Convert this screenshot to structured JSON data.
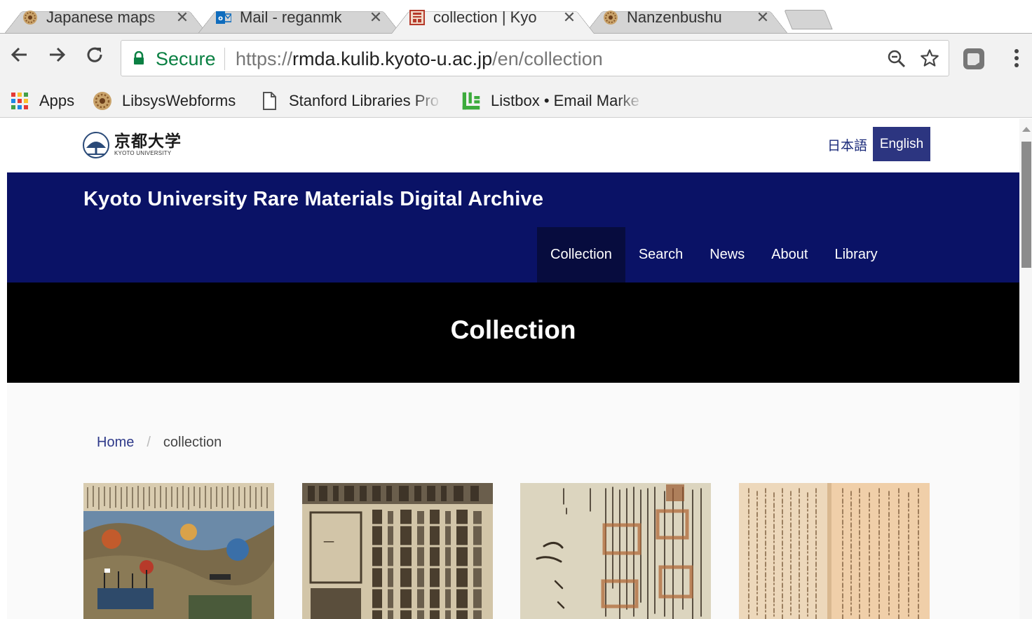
{
  "browser": {
    "tabs": [
      {
        "title": "Japanese maps",
        "icon": "daisy-icon"
      },
      {
        "title": "Mail - reganmk",
        "icon": "outlook-icon"
      },
      {
        "title": "collection | Kyo",
        "icon": "kyoto-seal-icon",
        "active": true
      },
      {
        "title": "Nanzenbushu",
        "icon": "daisy-icon"
      }
    ],
    "close_glyph": "✕",
    "address": {
      "secure_label": "Secure",
      "url_scheme": "https://",
      "url_host": "rmda.kulib.kyoto-u.ac.jp",
      "url_path": "/en/collection"
    },
    "bookmarks": [
      {
        "label": "Apps",
        "icon": "apps-grid-icon"
      },
      {
        "label": "LibsysWebforms",
        "icon": "daisy-icon"
      },
      {
        "label": "Stanford Libraries Pro",
        "icon": "page-icon"
      },
      {
        "label": "Listbox • Email Marke",
        "icon": "listbox-icon"
      }
    ]
  },
  "site": {
    "logo": {
      "kanji": "京都大学",
      "english": "KYOTO UNIVERSITY"
    },
    "lang_ja": "日本語",
    "lang_en": "English",
    "title": "Kyoto University Rare Materials Digital Archive",
    "nav": [
      {
        "label": "Collection",
        "active": true
      },
      {
        "label": "Search"
      },
      {
        "label": "News"
      },
      {
        "label": "About"
      },
      {
        "label": "Library"
      }
    ],
    "hero_title": "Collection",
    "breadcrumb": {
      "home": "Home",
      "separator": "/",
      "current": "collection"
    },
    "thumbnails": [
      "battle-woodblock-print",
      "map-grid-print",
      "manuscript-with-seals",
      "calligraphy-scroll"
    ]
  },
  "colors": {
    "banner": "#0a1266",
    "nav_active": "#070c3e",
    "lang_active": "#2c3580",
    "secure_green": "#0b8043",
    "link": "#2f3a8a"
  }
}
